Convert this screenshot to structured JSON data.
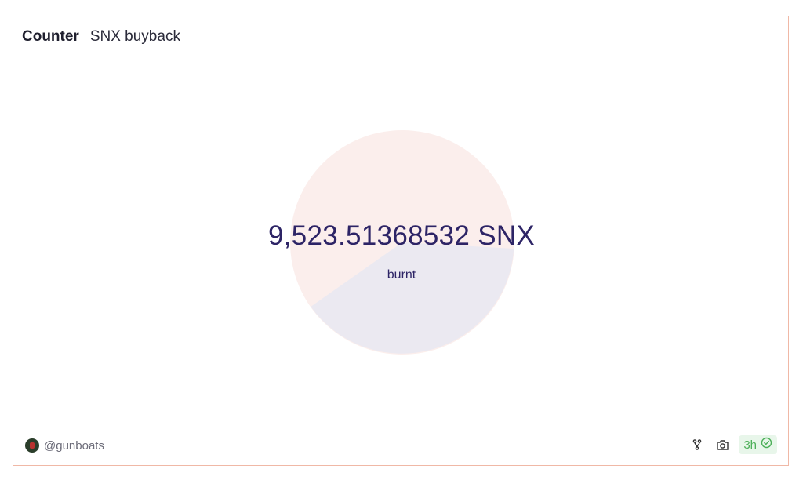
{
  "header": {
    "type_label": "Counter",
    "title": "SNX buyback"
  },
  "counter": {
    "value": "9,523.51368532 SNX",
    "label": "burnt"
  },
  "background_pie": {
    "slices": [
      {
        "share": 0.61,
        "color": "#fbeeec"
      },
      {
        "share": 0.39,
        "color": "#ebe9f1"
      }
    ]
  },
  "footer": {
    "author": "@gunboats",
    "freshness": "3h",
    "icons": {
      "fork": "fork-icon",
      "screenshot": "camera-icon",
      "status": "check-circle-icon"
    }
  },
  "colors": {
    "border": "#f0b8a6",
    "counter_text": "#2d2466",
    "freshness_bg": "#e8f6ea",
    "freshness_text": "#4caf58"
  }
}
